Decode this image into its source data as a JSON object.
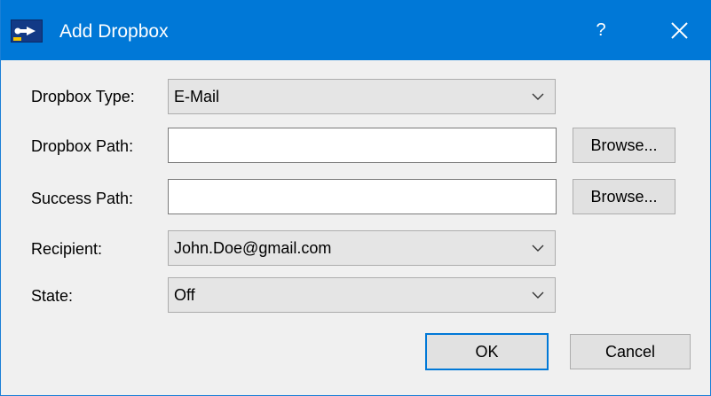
{
  "window": {
    "title": "Add Dropbox",
    "help_label": "?",
    "accent_color": "#0078d7"
  },
  "form": {
    "dropbox_type": {
      "label": "Dropbox Type:",
      "value": "E-Mail"
    },
    "dropbox_path": {
      "label": "Dropbox Path:",
      "value": "",
      "browse_label": "Browse..."
    },
    "success_path": {
      "label": "Success Path:",
      "value": "",
      "browse_label": "Browse..."
    },
    "recipient": {
      "label": "Recipient:",
      "value": "John.Doe@gmail.com"
    },
    "state": {
      "label": "State:",
      "value": "Off"
    }
  },
  "buttons": {
    "ok_label": "OK",
    "cancel_label": "Cancel"
  },
  "icons": {
    "app": "app-logo-icon",
    "help": "help-icon",
    "close": "close-icon",
    "chevron": "chevron-down-icon"
  }
}
